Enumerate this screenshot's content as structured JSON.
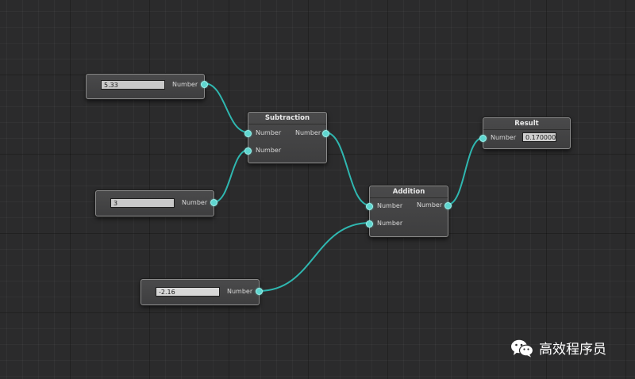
{
  "graph": {
    "nodes": {
      "input_a": {
        "value": "5.33",
        "out_label": "Number"
      },
      "input_b": {
        "value": "3",
        "out_label": "Number"
      },
      "input_c": {
        "value": "-2.16",
        "out_label": "Number"
      },
      "subtraction": {
        "title": "Subtraction",
        "in1_label": "Number",
        "in2_label": "Number",
        "out_label": "Number"
      },
      "addition": {
        "title": "Addition",
        "in1_label": "Number",
        "in2_label": "Number",
        "out_label": "Number"
      },
      "result": {
        "title": "Result",
        "in_label": "Number",
        "value": "0.170000"
      }
    },
    "wire_color": "#2fb7b0"
  },
  "watermark": {
    "text": "高效程序员",
    "icon": "wechat-icon"
  }
}
